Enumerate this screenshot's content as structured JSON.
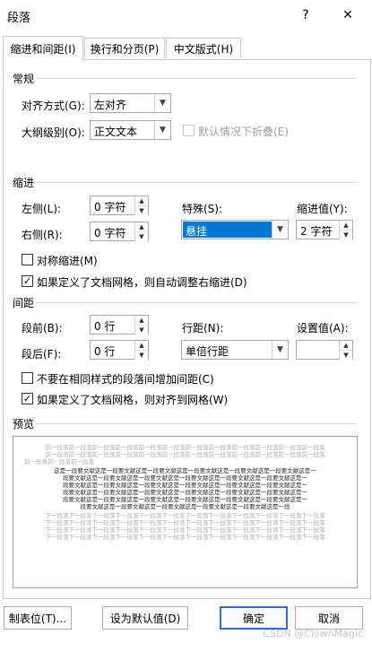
{
  "window": {
    "title": "段落",
    "help": "?",
    "close": "✕"
  },
  "tabs": [
    {
      "label": "缩进和间距(I)"
    },
    {
      "label": "换行和分页(P)"
    },
    {
      "label": "中文版式(H)"
    }
  ],
  "general": {
    "heading": "常规",
    "alignment": {
      "label": "对齐方式(G):",
      "value": "左对齐"
    },
    "outline": {
      "label": "大纲级别(O):",
      "value": "正文文本"
    },
    "collapsed": {
      "label": "默认情况下折叠(E)",
      "checked": false,
      "enabled": false
    }
  },
  "indent": {
    "heading": "缩进",
    "left": {
      "label": "左侧(L):",
      "value": "0 字符"
    },
    "right": {
      "label": "右侧(R):",
      "value": "0 字符"
    },
    "special": {
      "label": "特殊(S):",
      "value": "悬挂"
    },
    "by": {
      "label": "缩进值(Y):",
      "value": "2 字符"
    },
    "mirror": {
      "label": "对称缩进(M)",
      "checked": false
    },
    "auto_adjust": {
      "label": "如果定义了文档网格，则自动调整右缩进(D)",
      "checked": true
    }
  },
  "spacing": {
    "heading": "间距",
    "before": {
      "label": "段前(B):",
      "value": "0 行"
    },
    "after": {
      "label": "段后(F):",
      "value": "0 行"
    },
    "line": {
      "label": "行距(N):",
      "value": "单倍行距"
    },
    "at": {
      "label": "设置值(A):",
      "value": ""
    },
    "no_space_same": {
      "label": "不要在相同样式的段落间增加间距(C)",
      "checked": false
    },
    "snap_grid": {
      "label": "如果定义了文档网格，则对齐到网格(W)",
      "checked": true
    }
  },
  "preview": {
    "heading": "预览",
    "prev_lines": [
      "前一段落前一段落前一段落前一段落前一段落前一段落前一段落前一段落前一段落前一段落前一段落前一段落",
      "前一段落前一段落前一段落前一段落前一段落前一段落前一段落前一段落前一段落前一段落前一段落前一段落",
      "前一段落前一段落前一段落"
    ],
    "sample_lines": [
      "这是一段要文献这是一段要文献这是一段要文献这是一段要文献这是一段要文献这是一段要文献这是一",
      "段要文献这是一段要文献这是一段要文献这是一段要文献这是一段要文献这是一段要文献这是一",
      "段要文献这是一段要文献这是一段要文献这是一段要文献这是一段要文献这是一段要文献这是一",
      "段要文献这是一段要文献这是一段要文献这是一段要文献这是一段要文献这是一段要文献这是一",
      "段要文献这是一段要文献这是一段要文献这是一段要文献这是一段要文献这是一段要文献这是一",
      "段要文献这是一段要文献这是一段要文献这是一段要文献这是一段要文献这是一段"
    ],
    "next_lines": [
      "下一段落下一段落下一段落下一段落下一段落下一段落下一段落下一段落下一段落下一段落下一段落下一段落",
      "下一段落下一段落下一段落下一段落下一段落下一段落下一段落下一段落下一段落下一段落下一段落下一段落",
      "下一段落下一段落下一段落下一段落下一段落下一段落下一段落下一段落下一段落下一段落下一段落下一段落",
      "下一段落下一段落下一段落下一段落下一段落下一段落下一段落下一段落下一段落下一段落下一段落下一段落"
    ]
  },
  "buttons": {
    "tabs": "制表位(T)...",
    "set_default": "设为默认值(D)",
    "ok": "确定",
    "cancel": "取消"
  },
  "watermark": "CSDN @ClownMagic",
  "colors": {
    "accent": "#0078d7",
    "default_border": "#2a6ed8"
  }
}
